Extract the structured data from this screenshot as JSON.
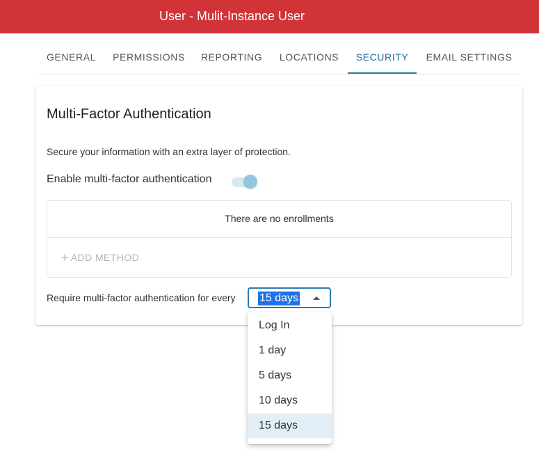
{
  "header": {
    "title": "User - Mulit-Instance User",
    "color": "#d13438"
  },
  "tabs": [
    {
      "label": "GENERAL"
    },
    {
      "label": "PERMISSIONS"
    },
    {
      "label": "REPORTING"
    },
    {
      "label": "LOCATIONS"
    },
    {
      "label": "SECURITY",
      "active": true
    },
    {
      "label": "EMAIL SETTINGS"
    }
  ],
  "security": {
    "title": "Multi-Factor Authentication",
    "description": "Secure your information with an extra layer of protection.",
    "toggle_label": "Enable multi-factor authentication",
    "toggle_on": true,
    "enrollments_empty": "There are no enrollments",
    "add_method_label": "ADD METHOD",
    "add_method_icon": "plus-icon",
    "require_label": "Require multi-factor authentication for every",
    "require_value": "15 days",
    "options": [
      "Log In",
      "1 day",
      "5 days",
      "10 days",
      "15 days"
    ],
    "selected_option": "15 days"
  },
  "colors": {
    "accent": "#2b7ab0",
    "active_tab_text": "#1d6f9e",
    "selection_highlight": "#1e73e8",
    "selected_option_bg": "#e3eff6"
  }
}
